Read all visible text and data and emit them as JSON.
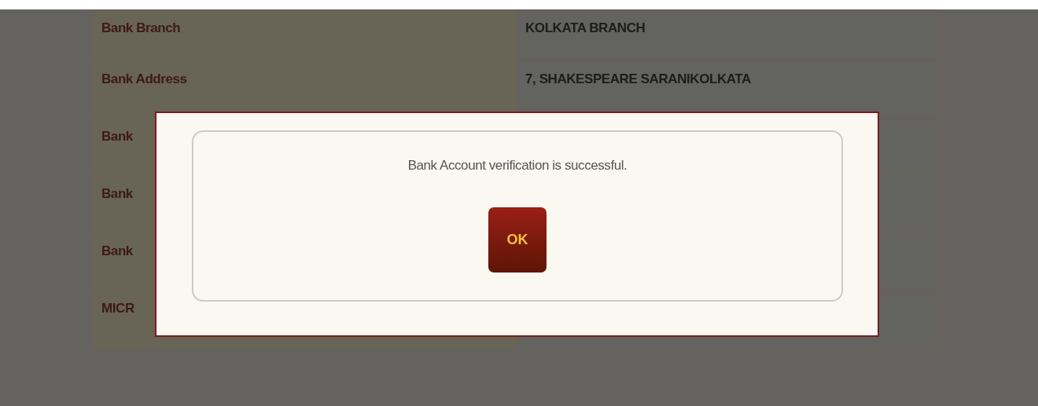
{
  "details_table": {
    "rows": [
      {
        "label": "Bank Branch",
        "value": "KOLKATA BRANCH"
      },
      {
        "label": "Bank Address",
        "value": "7, SHAKESPEARE SARANIKOLKATA"
      },
      {
        "label": "Bank"
      },
      {
        "label": "Bank"
      },
      {
        "label": "Bank"
      },
      {
        "label": "MICR"
      }
    ]
  },
  "dialog": {
    "message": "Bank Account verification is successful.",
    "button": "OK"
  }
}
